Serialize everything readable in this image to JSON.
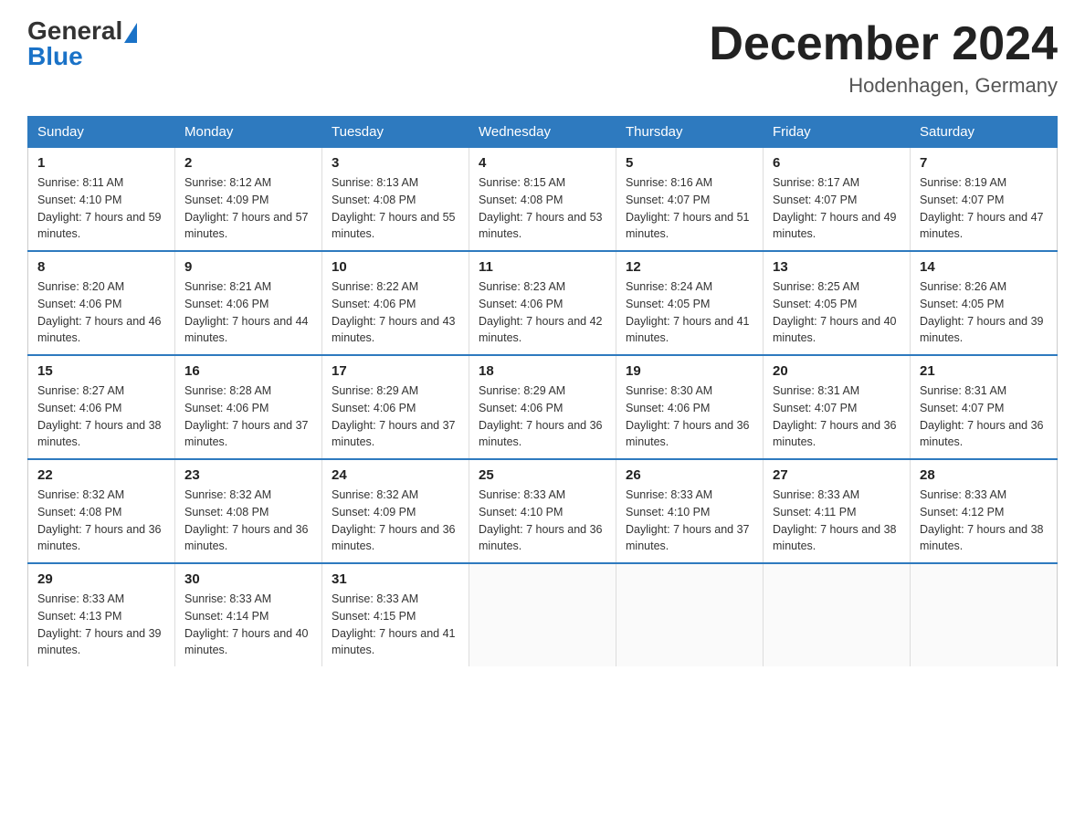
{
  "header": {
    "logo_general": "General",
    "logo_blue": "Blue",
    "title": "December 2024",
    "location": "Hodenhagen, Germany"
  },
  "weekdays": [
    "Sunday",
    "Monday",
    "Tuesday",
    "Wednesday",
    "Thursday",
    "Friday",
    "Saturday"
  ],
  "weeks": [
    [
      {
        "day": "1",
        "sunrise": "8:11 AM",
        "sunset": "4:10 PM",
        "daylight": "7 hours and 59 minutes."
      },
      {
        "day": "2",
        "sunrise": "8:12 AM",
        "sunset": "4:09 PM",
        "daylight": "7 hours and 57 minutes."
      },
      {
        "day": "3",
        "sunrise": "8:13 AM",
        "sunset": "4:08 PM",
        "daylight": "7 hours and 55 minutes."
      },
      {
        "day": "4",
        "sunrise": "8:15 AM",
        "sunset": "4:08 PM",
        "daylight": "7 hours and 53 minutes."
      },
      {
        "day": "5",
        "sunrise": "8:16 AM",
        "sunset": "4:07 PM",
        "daylight": "7 hours and 51 minutes."
      },
      {
        "day": "6",
        "sunrise": "8:17 AM",
        "sunset": "4:07 PM",
        "daylight": "7 hours and 49 minutes."
      },
      {
        "day": "7",
        "sunrise": "8:19 AM",
        "sunset": "4:07 PM",
        "daylight": "7 hours and 47 minutes."
      }
    ],
    [
      {
        "day": "8",
        "sunrise": "8:20 AM",
        "sunset": "4:06 PM",
        "daylight": "7 hours and 46 minutes."
      },
      {
        "day": "9",
        "sunrise": "8:21 AM",
        "sunset": "4:06 PM",
        "daylight": "7 hours and 44 minutes."
      },
      {
        "day": "10",
        "sunrise": "8:22 AM",
        "sunset": "4:06 PM",
        "daylight": "7 hours and 43 minutes."
      },
      {
        "day": "11",
        "sunrise": "8:23 AM",
        "sunset": "4:06 PM",
        "daylight": "7 hours and 42 minutes."
      },
      {
        "day": "12",
        "sunrise": "8:24 AM",
        "sunset": "4:05 PM",
        "daylight": "7 hours and 41 minutes."
      },
      {
        "day": "13",
        "sunrise": "8:25 AM",
        "sunset": "4:05 PM",
        "daylight": "7 hours and 40 minutes."
      },
      {
        "day": "14",
        "sunrise": "8:26 AM",
        "sunset": "4:05 PM",
        "daylight": "7 hours and 39 minutes."
      }
    ],
    [
      {
        "day": "15",
        "sunrise": "8:27 AM",
        "sunset": "4:06 PM",
        "daylight": "7 hours and 38 minutes."
      },
      {
        "day": "16",
        "sunrise": "8:28 AM",
        "sunset": "4:06 PM",
        "daylight": "7 hours and 37 minutes."
      },
      {
        "day": "17",
        "sunrise": "8:29 AM",
        "sunset": "4:06 PM",
        "daylight": "7 hours and 37 minutes."
      },
      {
        "day": "18",
        "sunrise": "8:29 AM",
        "sunset": "4:06 PM",
        "daylight": "7 hours and 36 minutes."
      },
      {
        "day": "19",
        "sunrise": "8:30 AM",
        "sunset": "4:06 PM",
        "daylight": "7 hours and 36 minutes."
      },
      {
        "day": "20",
        "sunrise": "8:31 AM",
        "sunset": "4:07 PM",
        "daylight": "7 hours and 36 minutes."
      },
      {
        "day": "21",
        "sunrise": "8:31 AM",
        "sunset": "4:07 PM",
        "daylight": "7 hours and 36 minutes."
      }
    ],
    [
      {
        "day": "22",
        "sunrise": "8:32 AM",
        "sunset": "4:08 PM",
        "daylight": "7 hours and 36 minutes."
      },
      {
        "day": "23",
        "sunrise": "8:32 AM",
        "sunset": "4:08 PM",
        "daylight": "7 hours and 36 minutes."
      },
      {
        "day": "24",
        "sunrise": "8:32 AM",
        "sunset": "4:09 PM",
        "daylight": "7 hours and 36 minutes."
      },
      {
        "day": "25",
        "sunrise": "8:33 AM",
        "sunset": "4:10 PM",
        "daylight": "7 hours and 36 minutes."
      },
      {
        "day": "26",
        "sunrise": "8:33 AM",
        "sunset": "4:10 PM",
        "daylight": "7 hours and 37 minutes."
      },
      {
        "day": "27",
        "sunrise": "8:33 AM",
        "sunset": "4:11 PM",
        "daylight": "7 hours and 38 minutes."
      },
      {
        "day": "28",
        "sunrise": "8:33 AM",
        "sunset": "4:12 PM",
        "daylight": "7 hours and 38 minutes."
      }
    ],
    [
      {
        "day": "29",
        "sunrise": "8:33 AM",
        "sunset": "4:13 PM",
        "daylight": "7 hours and 39 minutes."
      },
      {
        "day": "30",
        "sunrise": "8:33 AM",
        "sunset": "4:14 PM",
        "daylight": "7 hours and 40 minutes."
      },
      {
        "day": "31",
        "sunrise": "8:33 AM",
        "sunset": "4:15 PM",
        "daylight": "7 hours and 41 minutes."
      },
      null,
      null,
      null,
      null
    ]
  ]
}
